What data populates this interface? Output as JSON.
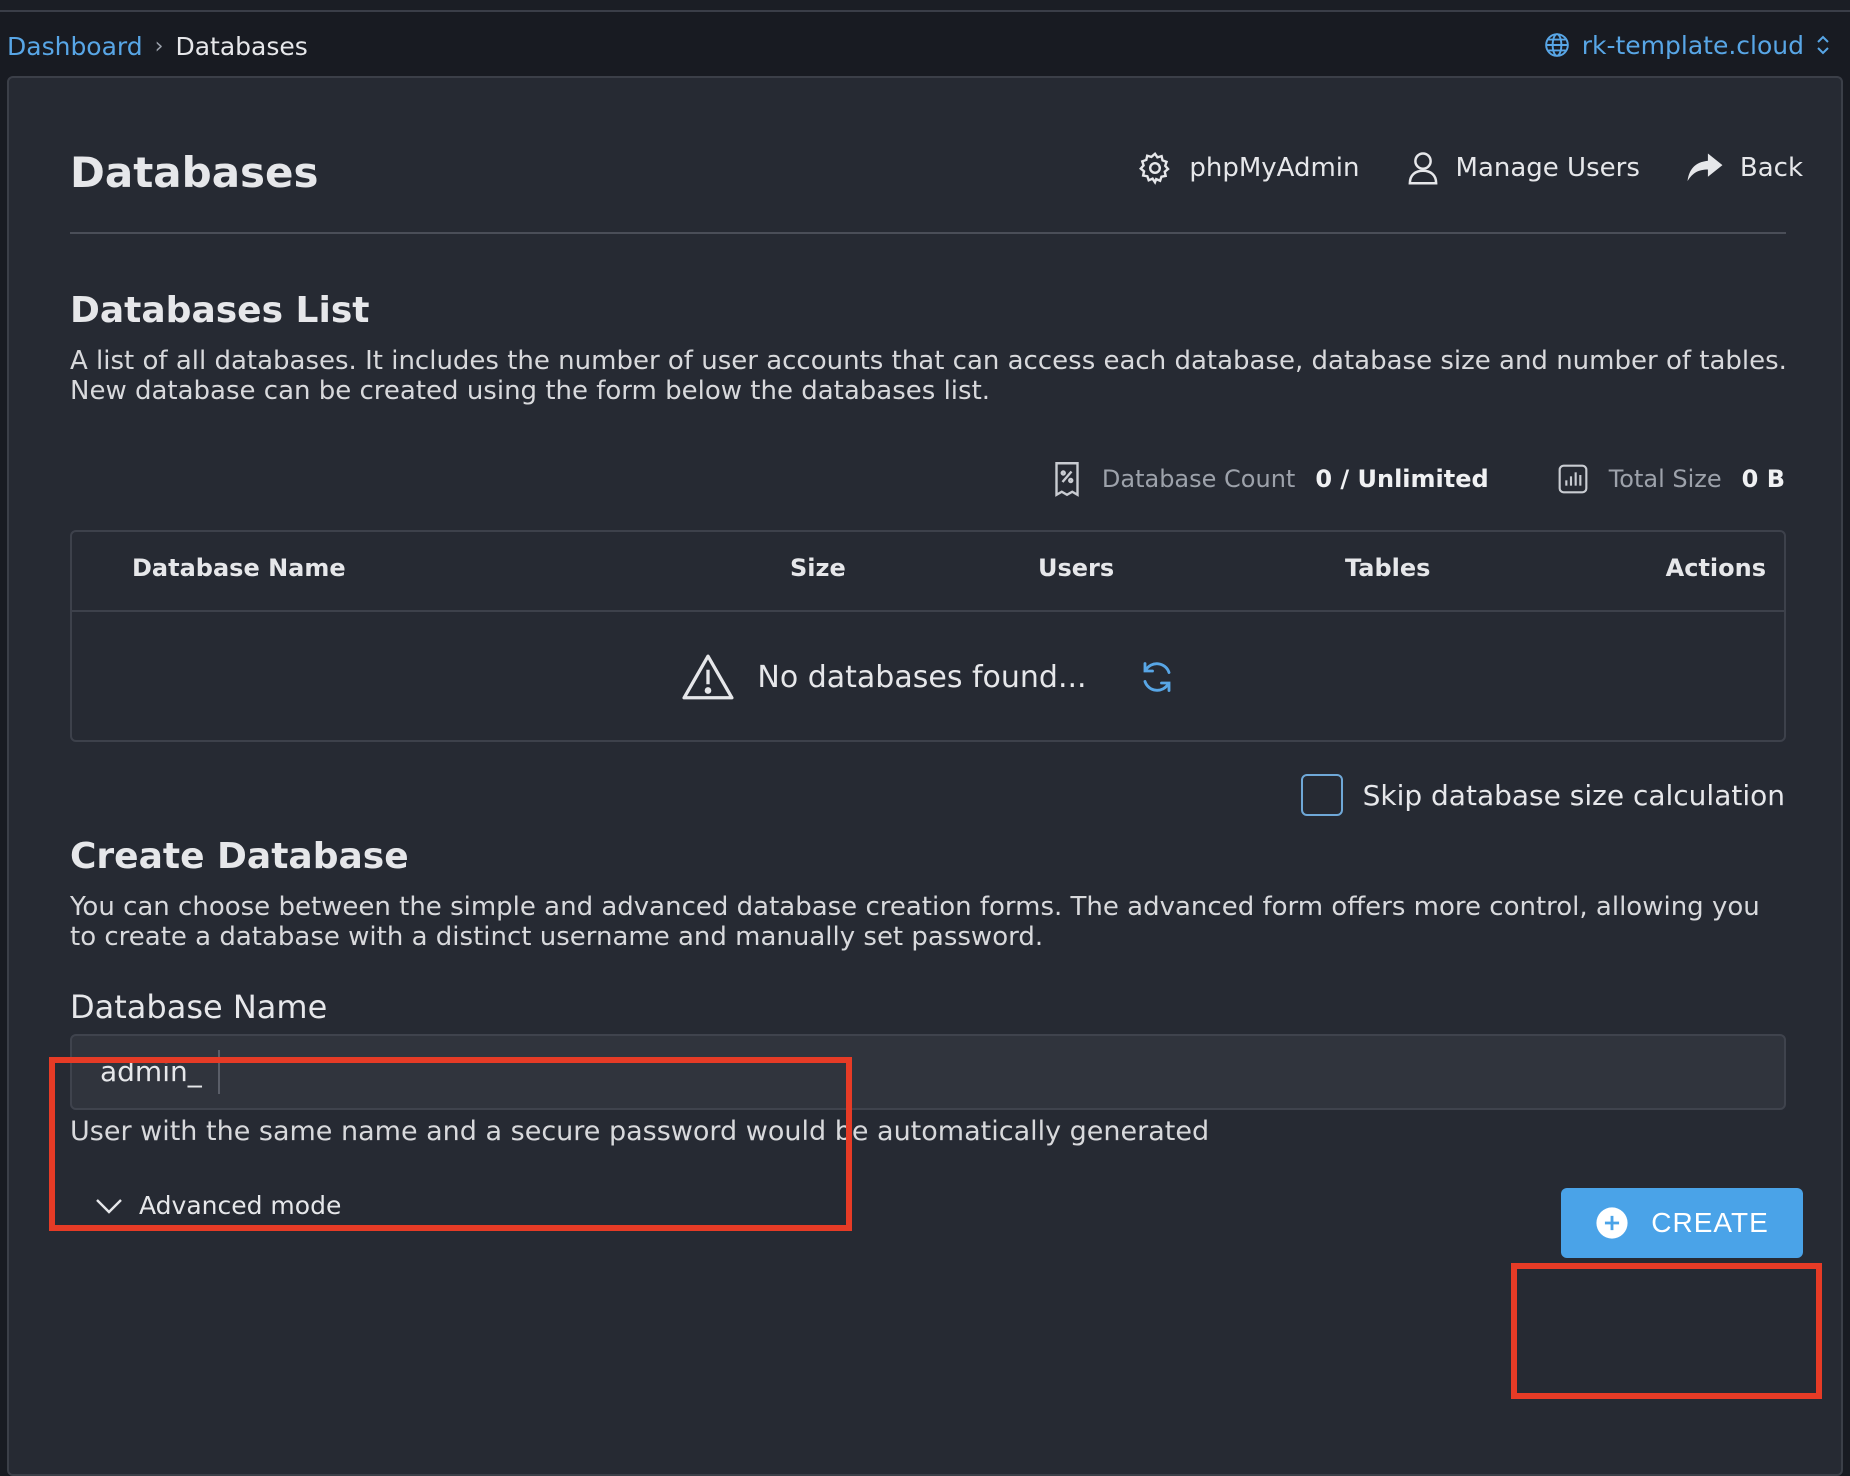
{
  "breadcrumb": {
    "dashboard": "Dashboard",
    "current": "Databases"
  },
  "domain": {
    "name": "rk-template.cloud"
  },
  "header": {
    "title": "Databases",
    "phpmyadmin_label": "phpMyAdmin",
    "manage_users_label": "Manage Users",
    "back_label": "Back"
  },
  "list": {
    "title": "Databases List",
    "description": "A list of all databases. It includes the number of user accounts that can access each database, database size and number of tables. New database can be created using the form below the databases list.",
    "stats": {
      "count_label": "Database Count",
      "count_value": "0 / Unlimited",
      "size_label": "Total Size",
      "size_value": "0 B"
    },
    "columns": [
      "Database Name",
      "Size",
      "Users",
      "Tables",
      "Actions"
    ],
    "empty_text": "No databases found...",
    "skip_label": "Skip database size calculation"
  },
  "create": {
    "title": "Create Database",
    "description": "You can choose between the simple and advanced database creation forms. The advanced form offers more control, allowing you to create a database with a distinct username and manually set password.",
    "name_label": "Database Name",
    "prefix": "admin_",
    "name_value": "",
    "hint": "User with the same name and a secure password would be automatically generated",
    "advanced_label": "Advanced mode",
    "create_label": "CREATE"
  },
  "colors": {
    "accent": "#4aa3e8",
    "link": "#58a6e6",
    "panel": "#262a33",
    "background": "#181b22",
    "highlight": "#e63b26"
  },
  "icons": [
    "globe-icon",
    "updown-chevron-icon",
    "gear-icon",
    "user-icon",
    "share-arrow-icon",
    "receipt-icon",
    "bar-chart-icon",
    "warning-icon",
    "refresh-icon",
    "chevron-down-icon",
    "plus-circle-icon"
  ]
}
